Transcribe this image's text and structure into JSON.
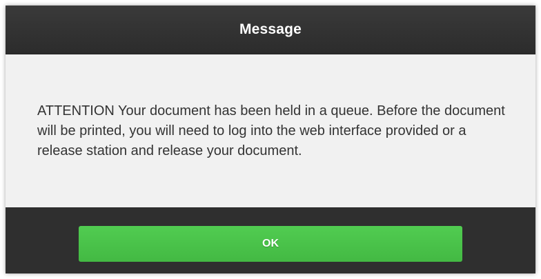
{
  "dialog": {
    "title": "Message",
    "message": "ATTENTION Your document has been held in a queue. Before the document will be printed, you will need to log into the web interface provided or a release station and release your document.",
    "ok_label": "OK"
  },
  "colors": {
    "titlebar": "#2f2f2f",
    "body_background": "#f1f1f1",
    "ok_button": "#4cc44c",
    "text": "#333333"
  }
}
